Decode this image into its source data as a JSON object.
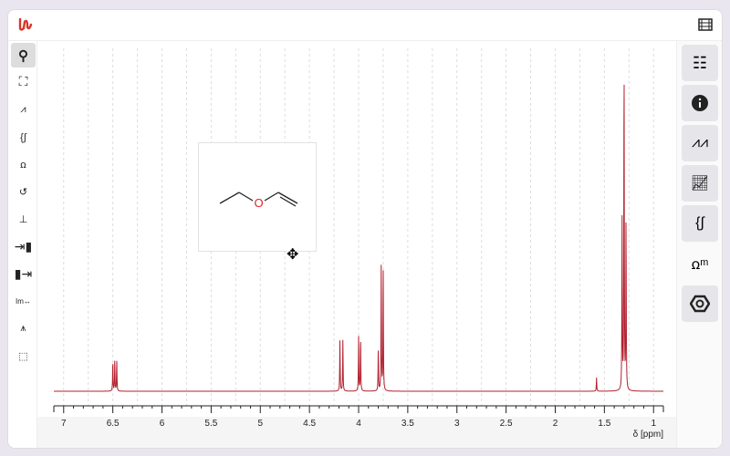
{
  "app": {
    "name": "NMRium"
  },
  "left_toolbar": {
    "tools": [
      "zoom",
      "zoom-out-full",
      "peak-picking",
      "integral",
      "multiplet-analysis",
      "phase-correction",
      "baseline-correction",
      "import",
      "export",
      "exclusion-zones",
      "apodization",
      "range-select"
    ],
    "active": "zoom"
  },
  "right_panel": {
    "buttons": [
      "spectra-panel",
      "information-panel",
      "peaks-panel",
      "chart-panel",
      "integrals-panel",
      "multiplets-panel",
      "structures-panel"
    ]
  },
  "molecule": {
    "name": "ethyl vinyl ether",
    "atom_label": "O",
    "atom_color": "#e52222"
  },
  "chart_data": {
    "type": "line",
    "xlabel": "δ [ppm]",
    "xlim": [
      7.1,
      0.9
    ],
    "ticks": [
      "7",
      "6.5",
      "6",
      "5.5",
      "5",
      "4.5",
      "4",
      "3.5",
      "3",
      "2.5",
      "2",
      "1.5",
      "1"
    ],
    "grid": true,
    "color": "#b0202e",
    "peaks": [
      {
        "ppm": 6.5,
        "intensity": 0.09
      },
      {
        "ppm": 6.48,
        "intensity": 0.09
      },
      {
        "ppm": 6.46,
        "intensity": 0.09
      },
      {
        "ppm": 4.19,
        "intensity": 0.15
      },
      {
        "ppm": 4.16,
        "intensity": 0.15
      },
      {
        "ppm": 4.0,
        "intensity": 0.16
      },
      {
        "ppm": 3.98,
        "intensity": 0.16
      },
      {
        "ppm": 3.8,
        "intensity": 0.12
      },
      {
        "ppm": 3.77,
        "intensity": 0.37
      },
      {
        "ppm": 3.75,
        "intensity": 0.37
      },
      {
        "ppm": 1.58,
        "intensity": 0.04
      },
      {
        "ppm": 1.32,
        "intensity": 0.5
      },
      {
        "ppm": 1.3,
        "intensity": 1.0
      },
      {
        "ppm": 1.28,
        "intensity": 0.5
      }
    ]
  }
}
